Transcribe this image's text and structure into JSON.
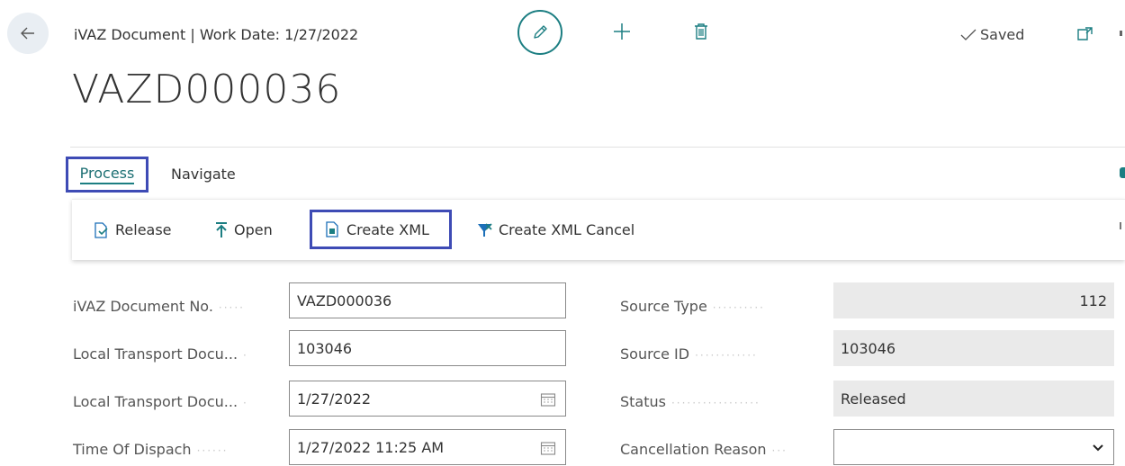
{
  "header": {
    "title": "iVAZ Document | Work Date: 1/27/2022",
    "saved_label": "Saved"
  },
  "page": {
    "title": "VAZD000036"
  },
  "tabs": [
    {
      "label": "Process",
      "selected": true
    },
    {
      "label": "Navigate",
      "selected": false
    }
  ],
  "actions": [
    {
      "label": "Release",
      "icon": "release-icon"
    },
    {
      "label": "Open",
      "icon": "open-icon"
    },
    {
      "label": "Create XML",
      "icon": "create-xml-icon"
    },
    {
      "label": "Create XML Cancel",
      "icon": "create-xml-cancel-icon"
    }
  ],
  "fields_left": [
    {
      "label": "iVAZ Document No.",
      "value": "VAZD000036"
    },
    {
      "label": "Local Transport Docu...",
      "value": "103046"
    },
    {
      "label": "Local Transport Docu...",
      "value": "1/27/2022"
    },
    {
      "label": "Time Of Dispach",
      "value": "1/27/2022 11:25 AM"
    }
  ],
  "fields_right": [
    {
      "label": "Source Type",
      "value": "112"
    },
    {
      "label": "Source ID",
      "value": "103046"
    },
    {
      "label": "Status",
      "value": "Released"
    },
    {
      "label": "Cancellation Reason",
      "value": ""
    }
  ],
  "colors": {
    "accent": "#1c7e82",
    "highlight_border": "#3e4bb5",
    "readonly_bg": "#eaeaea"
  }
}
